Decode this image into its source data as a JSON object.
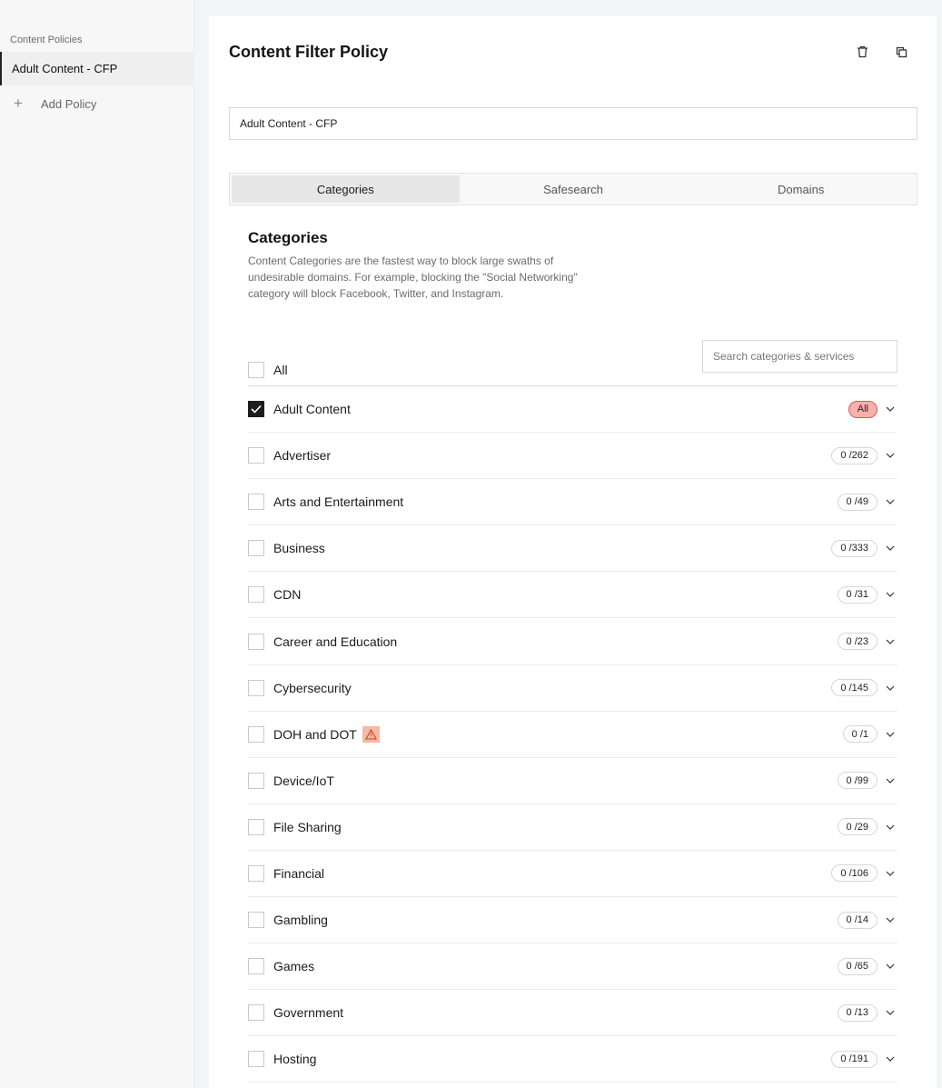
{
  "sidebar": {
    "heading": "Content Policies",
    "items": [
      {
        "label": "Adult Content - CFP"
      }
    ],
    "add_label": "Add Policy"
  },
  "header": {
    "title": "Content Filter Policy"
  },
  "policy_name": {
    "value": "Adult Content - CFP"
  },
  "tabs": [
    {
      "label": "Categories",
      "active": true
    },
    {
      "label": "Safesearch",
      "active": false
    },
    {
      "label": "Domains",
      "active": false
    }
  ],
  "section": {
    "title": "Categories",
    "description": "Content Categories are the fastest way to block large swaths of undesirable domains. For example, blocking the \"Social Networking\" category will block Facebook, Twitter, and Instagram."
  },
  "search": {
    "placeholder": "Search categories & services"
  },
  "all_row": {
    "label": "All"
  },
  "categories": [
    {
      "label": "Adult Content",
      "count": "All",
      "checked": true
    },
    {
      "label": "Advertiser",
      "count": "0 /262",
      "checked": false
    },
    {
      "label": "Arts and Entertainment",
      "count": "0 /49",
      "checked": false
    },
    {
      "label": "Business",
      "count": "0 /333",
      "checked": false
    },
    {
      "label": "CDN",
      "count": "0 /31",
      "checked": false
    },
    {
      "label": "Career and Education",
      "count": "0 /23",
      "checked": false
    },
    {
      "label": "Cybersecurity",
      "count": "0 /145",
      "checked": false
    },
    {
      "label": "DOH and DOT",
      "count": "0 /1",
      "checked": false,
      "warning": true
    },
    {
      "label": "Device/IoT",
      "count": "0 /99",
      "checked": false
    },
    {
      "label": "File Sharing",
      "count": "0 /29",
      "checked": false
    },
    {
      "label": "Financial",
      "count": "0 /106",
      "checked": false
    },
    {
      "label": "Gambling",
      "count": "0 /14",
      "checked": false
    },
    {
      "label": "Games",
      "count": "0 /65",
      "checked": false
    },
    {
      "label": "Government",
      "count": "0 /13",
      "checked": false
    },
    {
      "label": "Hosting",
      "count": "0 /191",
      "checked": false
    }
  ],
  "colors": {
    "accent": "#1d1d1d",
    "all_badge_bg": "#f6b1ad",
    "all_badge_border": "#d85a55",
    "warning_bg": "#f6b9a2"
  },
  "icons": {
    "delete": "trash-icon",
    "duplicate": "copy-icon",
    "add": "plus-icon",
    "expand": "chevron-down-icon",
    "warning": "warning-icon"
  }
}
